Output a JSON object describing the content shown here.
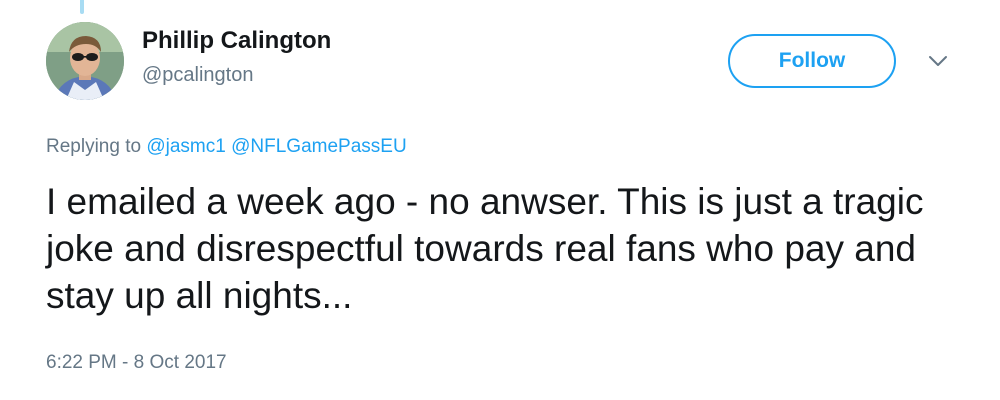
{
  "user": {
    "display_name": "Phillip Calington",
    "handle": "@pcalington"
  },
  "actions": {
    "follow_label": "Follow",
    "more_icon": "chevron-down-icon"
  },
  "reply": {
    "prefix": "Replying to",
    "mentions": [
      "@jasmc1",
      "@NFLGamePassEU"
    ]
  },
  "tweet": {
    "text": "I emailed a week ago - no anwser. This is just a tragic joke and disrespectful towards real fans who pay and stay up all nights...",
    "timestamp": "6:22 PM - 8 Oct 2017"
  },
  "colors": {
    "accent": "#1da1f2",
    "muted": "#657786",
    "text": "#14171a",
    "thread_line": "#a8dcf3"
  }
}
